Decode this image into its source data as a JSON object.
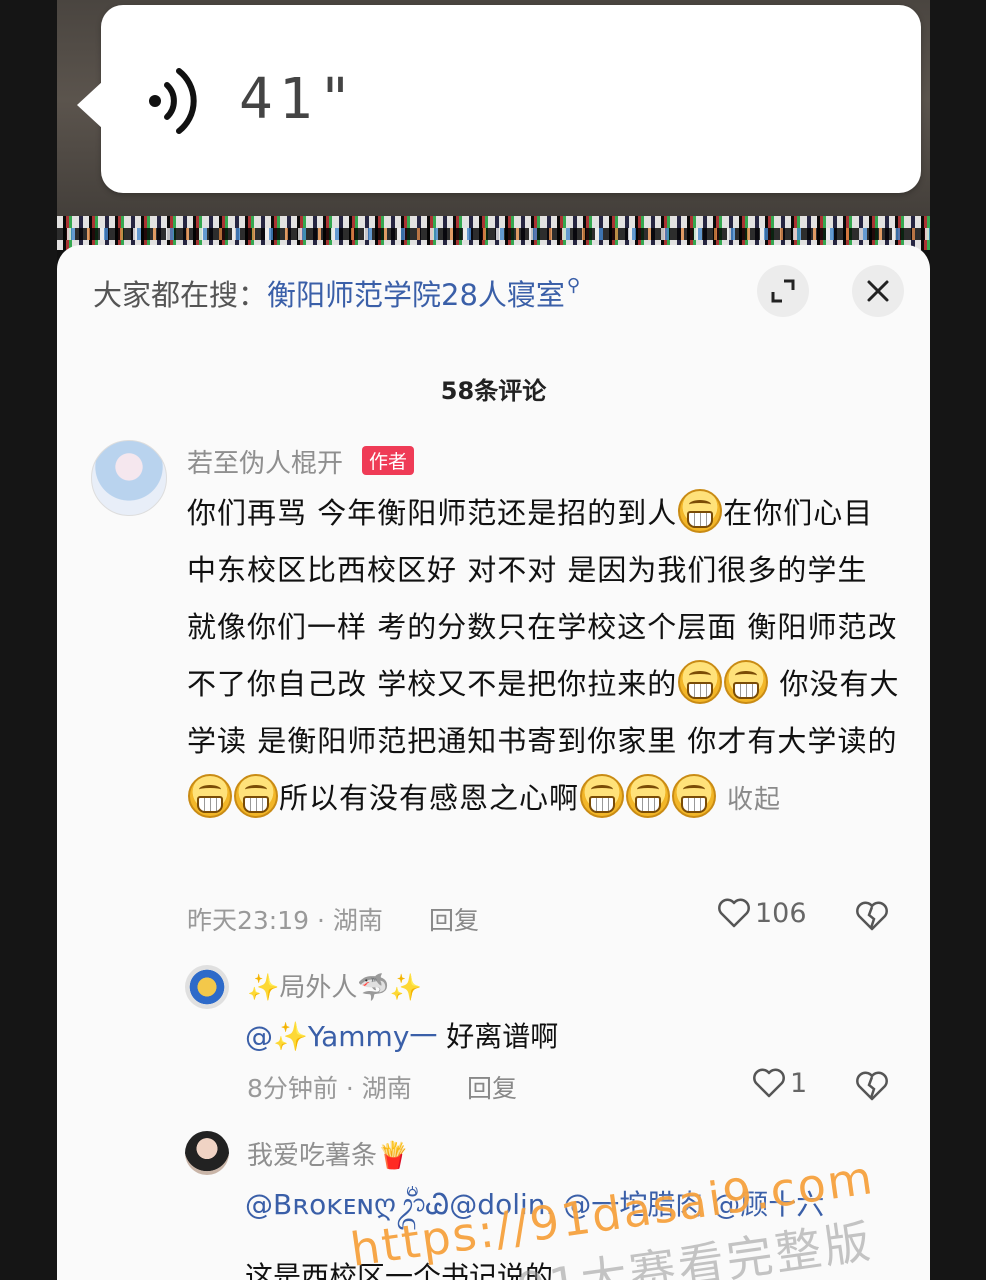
{
  "voice_message": {
    "duration": "41\""
  },
  "search_bar": {
    "label": "大家都在搜：",
    "term": "衡阳师范学院28人寝室",
    "icon": "search-icon"
  },
  "header": {
    "comment_count": "58条评论",
    "expand_icon": "expand-icon",
    "close_icon": "close-icon"
  },
  "main_comment": {
    "username": "若至伪人棍开",
    "badge": "作者",
    "text_segments": [
      "你们再骂  今年衡阳师范还是招的到人",
      "在你们心目中东校区比西校区好  对不对   是因为我们很多的学生  就像你们一样  考的分数只在学校这个层面  衡阳师范改不了你自己改  学校又不是把你拉来的",
      "  你没有大学读  是衡阳师范把通知书寄到你家里 你才有大学读的",
      "所以有没有感恩之心啊"
    ],
    "collapse_label": "收起",
    "time": "昨天23:19 · 湖南",
    "reply_label": "回复",
    "likes": "106"
  },
  "replies": [
    {
      "username": "✨局外人🦈✨",
      "mention": "@✨Yammy一",
      "text": " 好离谱啊",
      "time": "8分钟前 · 湖南",
      "reply_label": "回复",
      "likes": "1"
    },
    {
      "username": "我爱吃薯条🍟",
      "mentions": "@BʀᴏᴋᴇɴღᬊᬁᏊ@dolin. @一坨腊肉 @顾十六",
      "text_partial": "这是西校区一个书记说的"
    }
  ],
  "watermark": {
    "line1": "https://91dasai9.com",
    "line2": "91大赛看完整版"
  }
}
